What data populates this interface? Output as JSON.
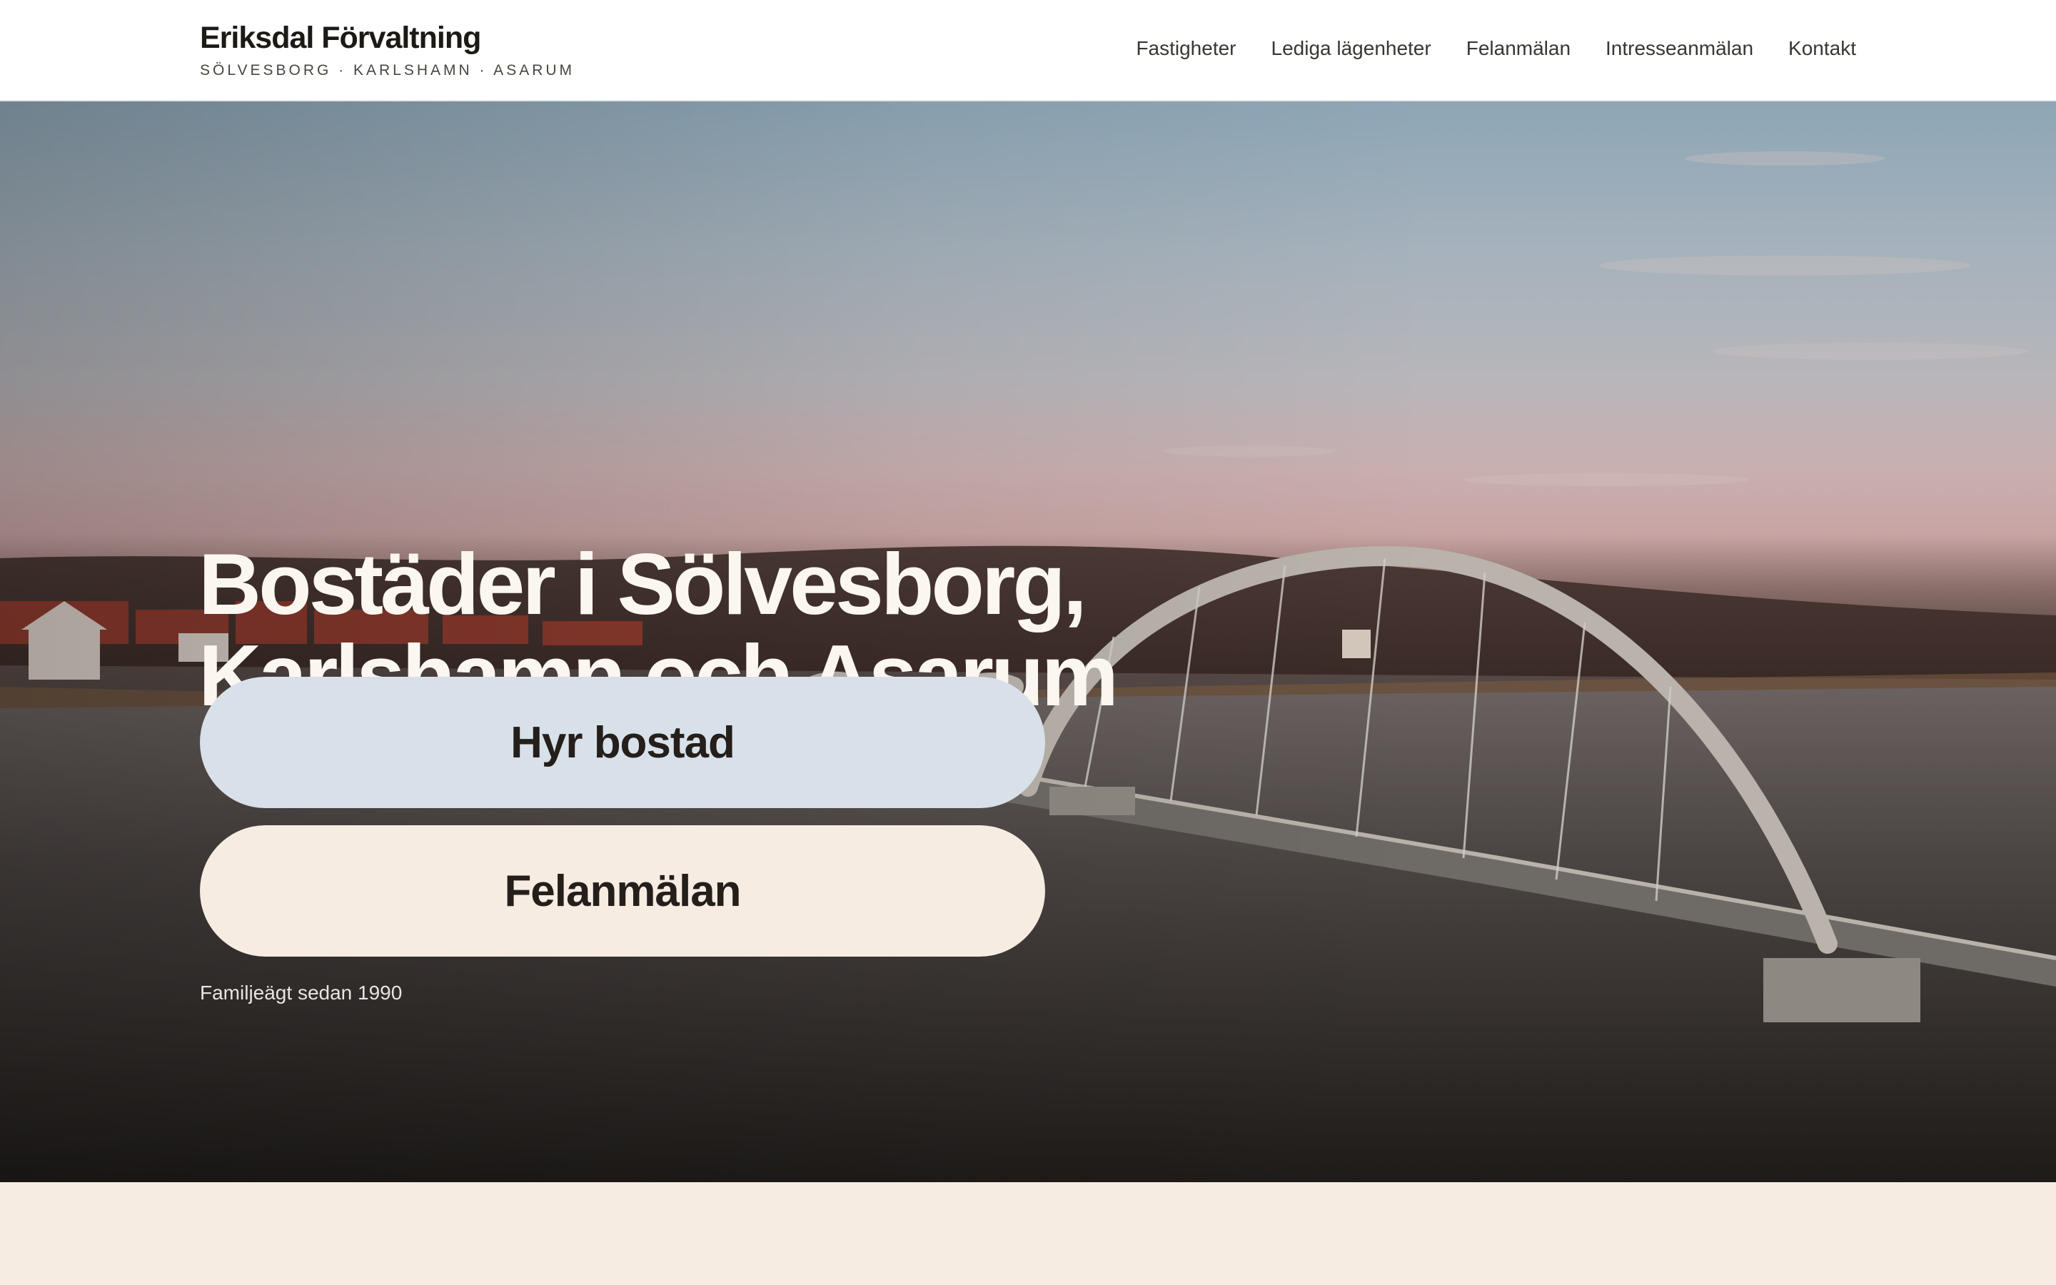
{
  "header": {
    "brand_name": "Eriksdal Förvaltning",
    "brand_tagline": "SÖLVESBORG · KARLSHAMN · ASARUM",
    "nav": [
      {
        "label": "Fastigheter"
      },
      {
        "label": "Lediga lägenheter"
      },
      {
        "label": "Felanmälan"
      },
      {
        "label": "Intresseanmälan"
      },
      {
        "label": "Kontakt"
      }
    ]
  },
  "hero": {
    "title_line1": "Bostäder i Sölvesborg,",
    "title_line2": "Karlshamn och Asarum",
    "primary_cta": "Hyr bostad",
    "secondary_cta": "Felanmälan",
    "note": "Familjeägt sedan 1990"
  },
  "colors": {
    "primary_button": "#d8e1ea",
    "secondary_button": "#f6ece2",
    "header_bg": "#ffffff",
    "page_bg": "#f6ece2"
  }
}
